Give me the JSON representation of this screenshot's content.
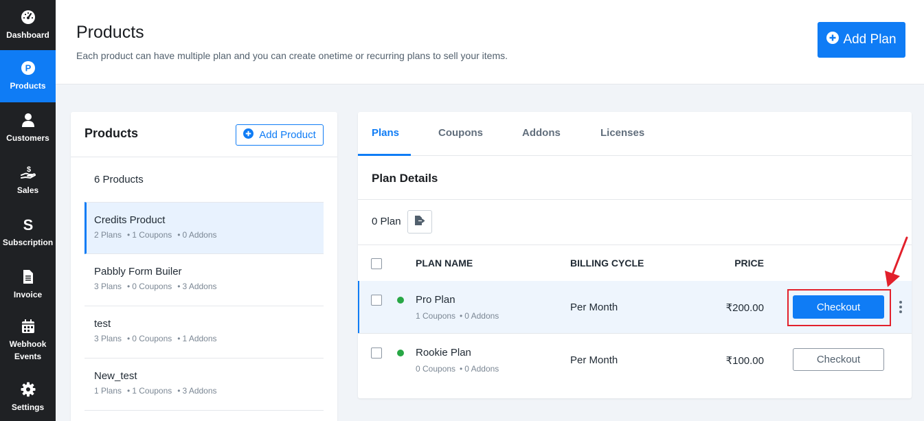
{
  "sidebar": {
    "items": [
      {
        "label": "Dashboard",
        "icon": "dashboard-gauge-icon",
        "active": false
      },
      {
        "label": "Products",
        "icon": "products-p-icon",
        "active": true
      },
      {
        "label": "Customers",
        "icon": "user-icon",
        "active": false
      },
      {
        "label": "Sales",
        "icon": "sales-hand-dollar-icon",
        "active": false
      },
      {
        "label": "Subscription",
        "icon": "subscription-s-icon",
        "active": false
      },
      {
        "label": "Invoice",
        "icon": "invoice-document-icon",
        "active": false
      },
      {
        "label": "Webhook\nEvents",
        "icon": "calendar-icon",
        "active": false
      },
      {
        "label": "Settings",
        "icon": "gear-icon",
        "active": false
      }
    ]
  },
  "header": {
    "title": "Products",
    "subtitle": "Each product can have multiple plan and you can create onetime or recurring plans to sell your items.",
    "add_plan_label": "Add Plan"
  },
  "products_panel": {
    "title": "Products",
    "add_product_label": "Add Product",
    "count_label": "6 Products",
    "items": [
      {
        "name": "Credits Product",
        "plans": "2 Plans",
        "coupons": "1 Coupons",
        "addons": "0 Addons",
        "active": true
      },
      {
        "name": "Pabbly Form Builer",
        "plans": "3 Plans",
        "coupons": "0 Coupons",
        "addons": "3 Addons",
        "active": false
      },
      {
        "name": "test",
        "plans": "3 Plans",
        "coupons": "0 Coupons",
        "addons": "1 Addons",
        "active": false
      },
      {
        "name": "New_test",
        "plans": "1 Plans",
        "coupons": "1 Coupons",
        "addons": "3 Addons",
        "active": false
      }
    ]
  },
  "plans_panel": {
    "tabs": [
      {
        "label": "Plans",
        "active": true
      },
      {
        "label": "Coupons",
        "active": false
      },
      {
        "label": "Addons",
        "active": false
      },
      {
        "label": "Licenses",
        "active": false
      }
    ],
    "section_title": "Plan Details",
    "plan_count": "0 Plan",
    "columns": {
      "plan_name": "PLAN NAME",
      "billing_cycle": "BILLING CYCLE",
      "price": "PRICE"
    },
    "rows": [
      {
        "name": "Pro Plan",
        "coupons": "1 Coupons",
        "addons": "0 Addons",
        "billing_cycle": "Per Month",
        "price": "₹200.00",
        "checkout_label": "Checkout",
        "status_color": "#28a745",
        "highlighted": true
      },
      {
        "name": "Rookie Plan",
        "coupons": "0 Coupons",
        "addons": "0 Addons",
        "billing_cycle": "Per Month",
        "price": "₹100.00",
        "checkout_label": "Checkout",
        "status_color": "#28a745",
        "highlighted": false
      }
    ]
  },
  "colors": {
    "accent": "#0f7cf5",
    "sidebar_bg": "#1f2124",
    "annotation_red": "#e2202b",
    "status_active": "#28a745"
  }
}
